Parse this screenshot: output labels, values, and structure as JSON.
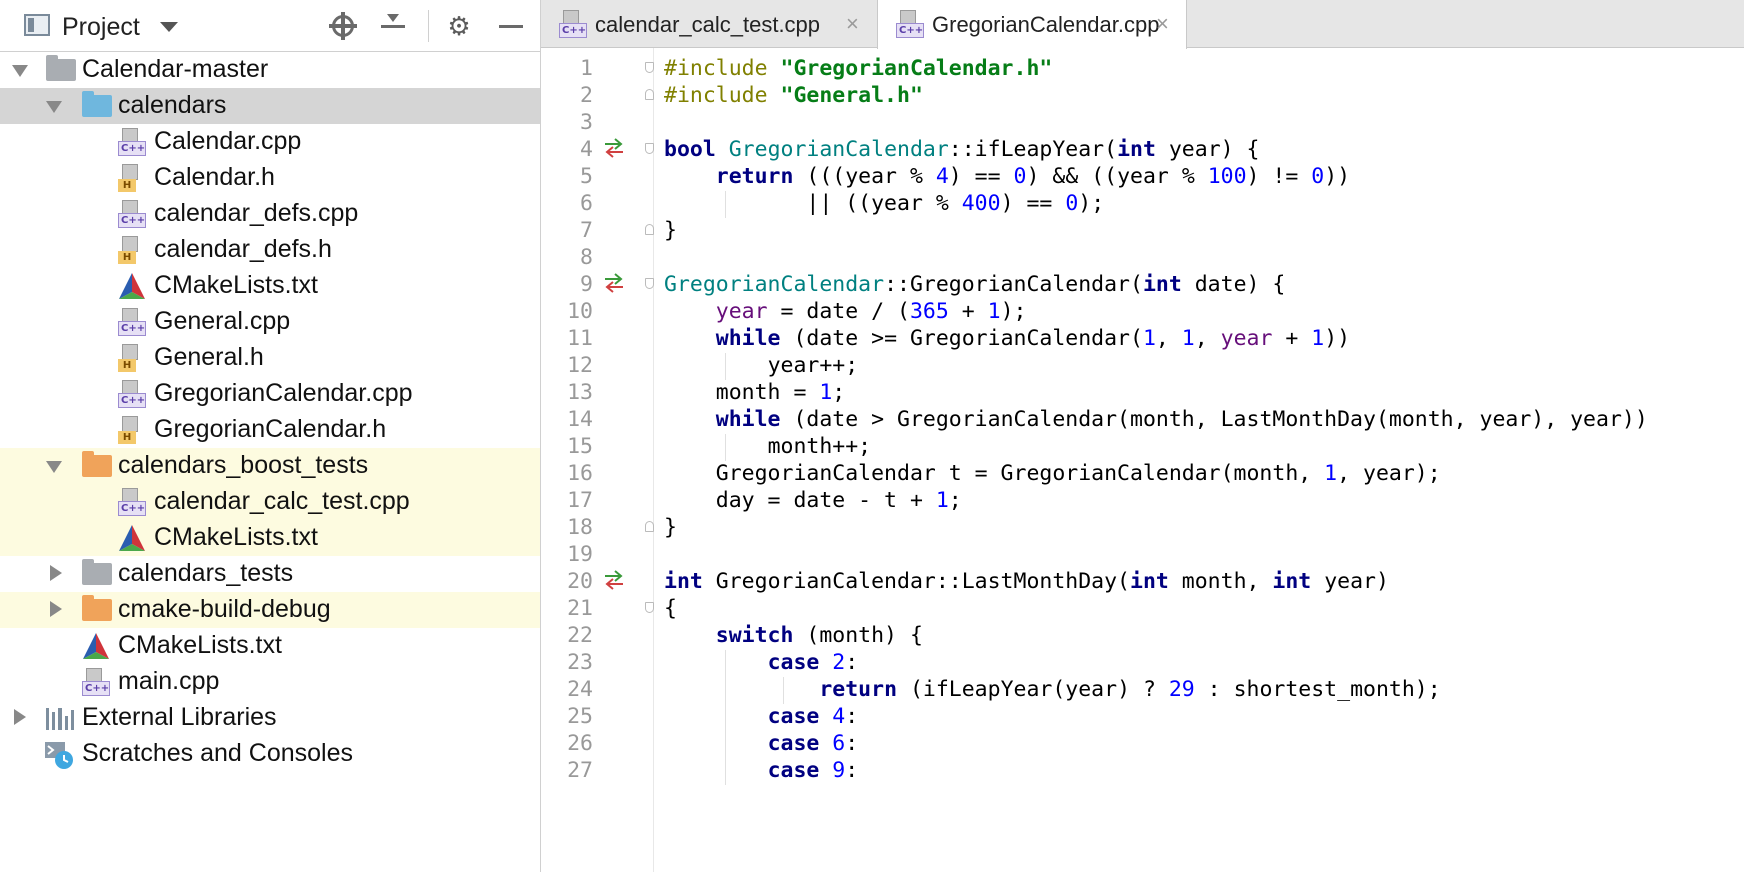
{
  "project_panel": {
    "title": "Project",
    "toolbar": [
      "locate-icon",
      "collapse-all-icon",
      "gear-icon",
      "minimize-icon"
    ],
    "tree": [
      {
        "label": "Calendar-master",
        "kind": "folder",
        "color": "gray",
        "expanded": true
      },
      {
        "label": "calendars",
        "kind": "folder",
        "color": "blue",
        "expanded": true,
        "selected": true
      },
      {
        "label": "Calendar.cpp",
        "kind": "cpp"
      },
      {
        "label": "Calendar.h",
        "kind": "h"
      },
      {
        "label": "calendar_defs.cpp",
        "kind": "cpp"
      },
      {
        "label": "calendar_defs.h",
        "kind": "h"
      },
      {
        "label": "CMakeLists.txt",
        "kind": "cmake"
      },
      {
        "label": "General.cpp",
        "kind": "cpp"
      },
      {
        "label": "General.h",
        "kind": "h"
      },
      {
        "label": "GregorianCalendar.cpp",
        "kind": "cpp"
      },
      {
        "label": "GregorianCalendar.h",
        "kind": "h"
      },
      {
        "label": "calendars_boost_tests",
        "kind": "folder",
        "color": "orange",
        "expanded": true
      },
      {
        "label": "calendar_calc_test.cpp",
        "kind": "cpp"
      },
      {
        "label": "CMakeLists.txt",
        "kind": "cmake"
      },
      {
        "label": "calendars_tests",
        "kind": "folder",
        "color": "gray",
        "expanded": false
      },
      {
        "label": "cmake-build-debug",
        "kind": "folder",
        "color": "orange",
        "expanded": false
      },
      {
        "label": "CMakeLists.txt",
        "kind": "cmake"
      },
      {
        "label": "main.cpp",
        "kind": "cpp"
      },
      {
        "label": "External Libraries",
        "kind": "library",
        "expanded": false
      },
      {
        "label": "Scratches and Consoles",
        "kind": "scratches"
      }
    ]
  },
  "editor": {
    "tabs": [
      {
        "label": "calendar_calc_test.cpp",
        "active": false,
        "close": "×"
      },
      {
        "label": "GregorianCalendar.cpp",
        "active": true,
        "close": "×"
      }
    ],
    "line_numbers": [
      "1",
      "2",
      "3",
      "4",
      "5",
      "6",
      "7",
      "8",
      "9",
      "10",
      "11",
      "12",
      "13",
      "14",
      "15",
      "16",
      "17",
      "18",
      "19",
      "20",
      "21",
      "22",
      "23",
      "24",
      "25",
      "26",
      "27"
    ],
    "code_text": {
      "l1a": "#include ",
      "l1b": "\"GregorianCalendar.h\"",
      "l2a": "#include ",
      "l2b": "\"General.h\"",
      "bool": "bool",
      "GregorianCalendar": "GregorianCalendar",
      "ifLeapYear_sig": "::ifLeapYear(",
      "int": "int",
      "year_param": " year) {",
      "return": "return",
      "l5a": " (((year % ",
      "four": "4",
      "l5b": ") == ",
      "zero": "0",
      "l5c": ") && ((year % ",
      "hundred": "100",
      "l5d": ") != ",
      "l5e": "))",
      "l6a": "|| ((year % ",
      "fourhundred": "400",
      "l6b": ") == ",
      "l6c": ");",
      "close_brace": "}",
      "ctor_sig": "::GregorianCalendar(",
      "date_param": " date) {",
      "year": "year",
      "l10a": " = date / (",
      "n365": "365",
      "plus": " + ",
      "one": "1",
      "l10b": ");",
      "while": "while",
      "l11a": " (date >= GregorianCalendar(",
      "comma": ", ",
      "l11b": "))",
      "yearpp": "year++;",
      "l13": "month = ",
      "semicolon": ";",
      "l14": " (date > GregorianCalendar(month, LastMonthDay(month, year), year))",
      "monthpp": "month++;",
      "l16a": "GregorianCalendar t = GregorianCalendar(month, ",
      "l16b": ", year);",
      "l17a": "day = date - t + ",
      "lmd_sig": " GregorianCalendar::LastMonthDay(",
      "month_param": " month, ",
      "year_close": " year)",
      "open_brace": "{",
      "switch": "switch",
      "switch_rest": " (month) {",
      "case": "case",
      "colon": ":",
      "two": "2",
      "l24a": " (ifLeapYear(year) ? ",
      "n29": "29",
      "l24b": " : shortest_month);",
      "six": "6",
      "nine": "9"
    }
  }
}
